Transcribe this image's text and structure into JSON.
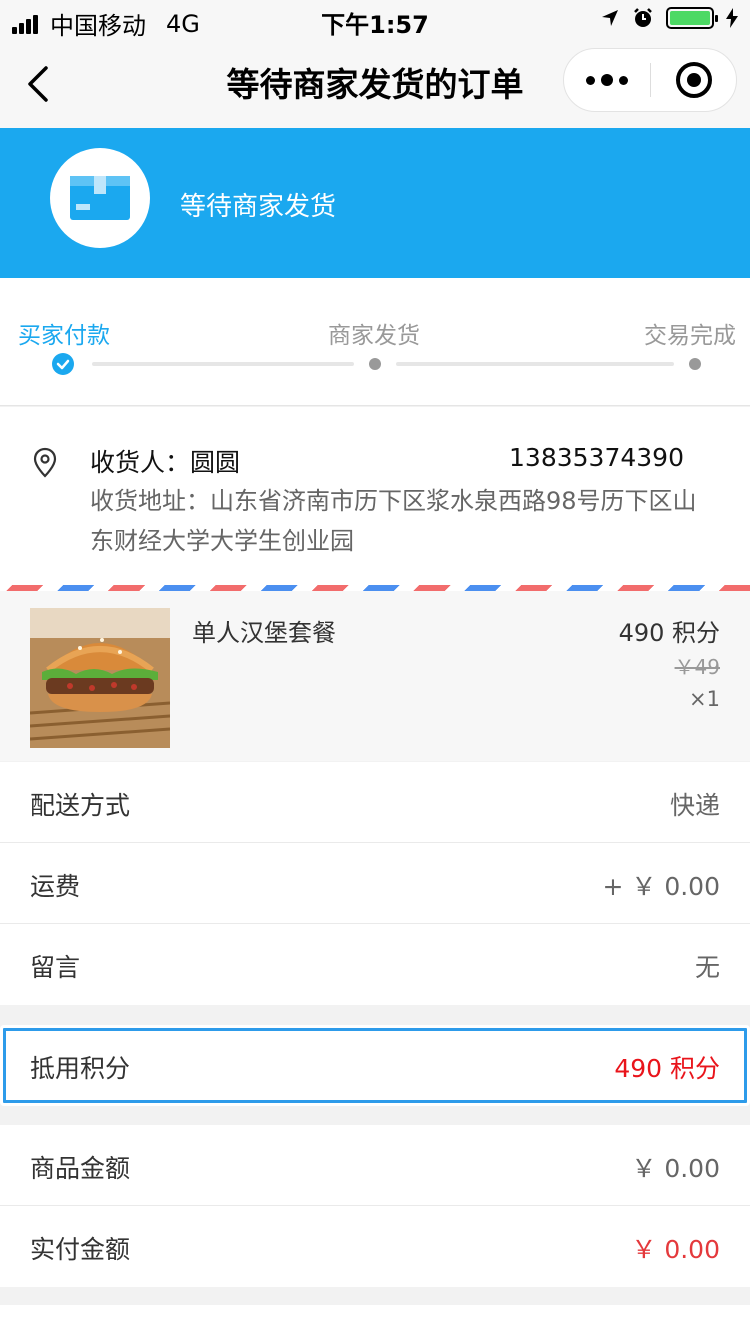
{
  "status_bar": {
    "carrier": "中国移动",
    "network": "4G",
    "time": "下午1:57"
  },
  "nav": {
    "title": "等待商家发货的订单",
    "back_icon": "chevron-left-icon",
    "more_icon": "more-dots-icon",
    "close_icon": "target-circle-icon"
  },
  "banner": {
    "icon": "package-box-icon",
    "text": "等待商家发货",
    "color": "#1ba8ef"
  },
  "progress": {
    "steps": [
      {
        "label": "买家付款",
        "state": "done"
      },
      {
        "label": "商家发货",
        "state": "pending"
      },
      {
        "label": "交易完成",
        "state": "pending"
      }
    ]
  },
  "address": {
    "icon": "location-pin-icon",
    "recipient": "收货人：圆圆",
    "phone": "13835374390",
    "detail": "收货地址：山东省济南市历下区浆水泉西路98号历下区山东财经大学大学生创业园"
  },
  "product": {
    "name": "单人汉堡套餐",
    "points": "490 积分",
    "original_price": "￥49",
    "quantity": "×1",
    "image": "hamburger-photo"
  },
  "details": {
    "shipping_label": "配送方式",
    "shipping_value": "快递",
    "freight_label": "运费",
    "freight_value": "+ ￥ 0.00",
    "message_label": "留言",
    "message_value": "无"
  },
  "points": {
    "label": "抵用积分",
    "value": "490 积分"
  },
  "amounts": {
    "goods_label": "商品金额",
    "goods_value": "￥ 0.00",
    "paid_label": "实付金额",
    "paid_value": "￥ 0.00"
  },
  "colors": {
    "accent": "#1ba8ef",
    "price_red": "#e4393c",
    "highlight_border": "#2d9bea"
  }
}
